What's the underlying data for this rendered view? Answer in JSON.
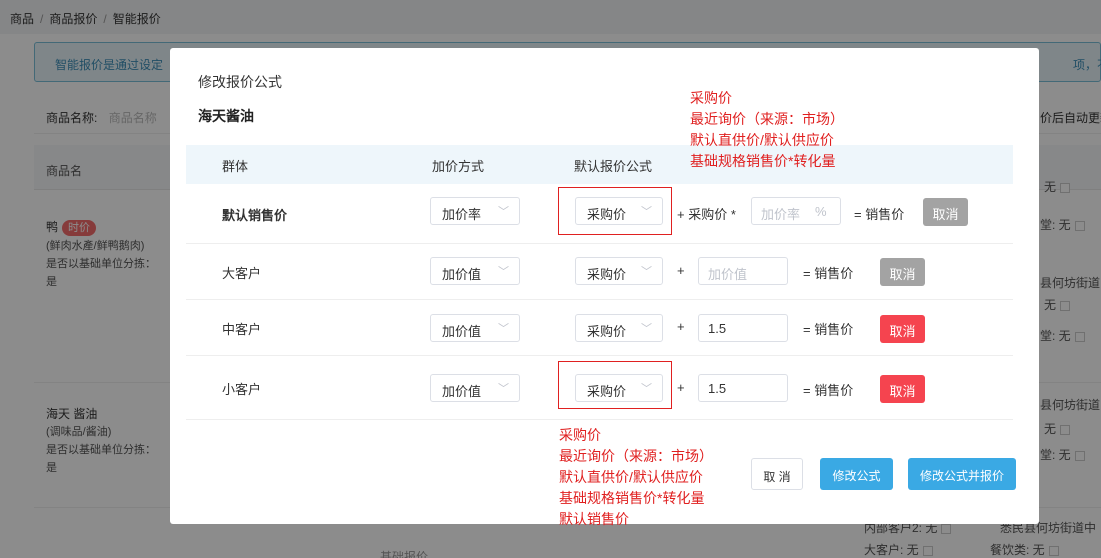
{
  "breadcrumb": [
    "商品",
    "商品报价",
    "智能报价"
  ],
  "background": {
    "notice_text": "智能报价是通过设定",
    "notice_tail": "项，不会进",
    "filter_label": "商品名称:",
    "filter_placeholder": "商品名称",
    "filter_tail": "价后自动更新",
    "column_header": "商品名",
    "bottom_label": "基础报价",
    "products": [
      {
        "name": "鸭",
        "tag": "时价",
        "category": "(鲜肉水產/鲜鸭鹅肉)",
        "split_question": "是否以基础单位分拣：",
        "split_answer": "是"
      },
      {
        "name": "海天 酱油",
        "category": "(调味品/酱油)",
        "split_question": "是否以基础单位分拣：",
        "split_answer": "是"
      }
    ],
    "right_snippets": [
      "无",
      "堂:  无",
      "县何坊街道中",
      "无",
      "堂:  无",
      "县何坊街道中",
      "无",
      "堂:  无",
      "内部客户2:  无",
      "悉民县何坊街道中",
      "大客户:  无",
      "餐饮类:  无"
    ]
  },
  "modal": {
    "title": "修改报价公式",
    "product_name": "海天酱油",
    "headers": {
      "group": "群体",
      "markup_method": "加价方式",
      "default_formula": "默认报价公式"
    },
    "rows": [
      {
        "group": "默认销售价",
        "method": "加价率",
        "base": "采购价",
        "op": "+ 采购价 *",
        "value": "加价率",
        "unit": "%",
        "is_placeholder": true,
        "result": "= 销售价",
        "cancel": "取消",
        "cancel_style": "gray"
      },
      {
        "group": "大客户",
        "method": "加价值",
        "base": "采购价",
        "op": "+",
        "value": "加价值",
        "is_placeholder": true,
        "result": "= 销售价",
        "cancel": "取消",
        "cancel_style": "gray"
      },
      {
        "group": "中客户",
        "method": "加价值",
        "base": "采购价",
        "op": "+",
        "value": "1.5",
        "is_placeholder": false,
        "result": "= 销售价",
        "cancel": "取消",
        "cancel_style": "red"
      },
      {
        "group": "小客户",
        "method": "加价值",
        "base": "采购价",
        "op": "+",
        "value": "1.5",
        "is_placeholder": false,
        "result": "= 销售价",
        "cancel": "取消",
        "cancel_style": "red"
      }
    ],
    "footer": {
      "cancel": "取 消",
      "modify": "修改公式",
      "modify_and_quote": "修改公式并报价"
    }
  },
  "annotations": {
    "top": [
      "采购价",
      "最近询价（来源：市场）",
      "默认直供价/默认供应价",
      "基础规格销售价*转化量"
    ],
    "bottom": [
      "采购价",
      "最近询价（来源：市场）",
      "默认直供价/默认供应价",
      "基础规格销售价*转化量",
      "默认销售价"
    ]
  },
  "colors": {
    "accent_blue": "#3aa9e4",
    "danger_red": "#f5444f",
    "annotation_red": "#e02020",
    "header_bg": "#eef6fb"
  }
}
